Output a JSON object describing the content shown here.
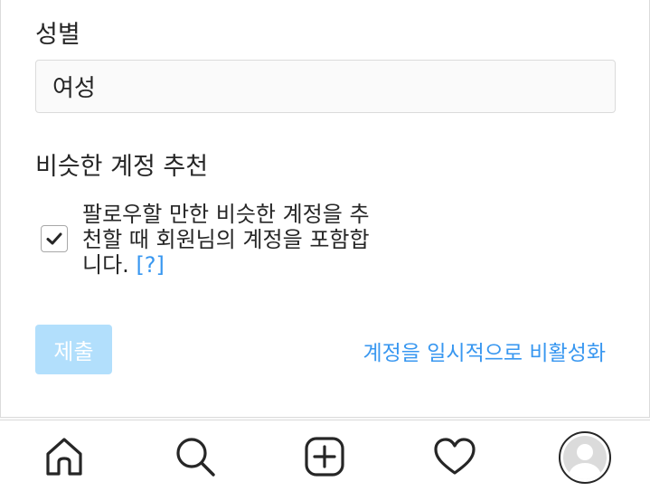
{
  "form": {
    "gender_label": "성별",
    "gender_value": "여성",
    "similar_label": "비슷한 계정 추천",
    "similar_checkbox_checked": true,
    "similar_text": "팔로우할 만한 비슷한 계정을 추천할 때 회원님의 계정을 포함합니다.",
    "help_link": "[?]",
    "submit_label": "제출",
    "deactivate_label": "계정을 일시적으로 비활성화"
  },
  "colors": {
    "link": "#3897f0",
    "submit_disabled": "#b2dffc",
    "border": "#dbdbdb"
  },
  "nav": {
    "items": [
      {
        "icon": "home-icon"
      },
      {
        "icon": "search-icon"
      },
      {
        "icon": "add-post-icon"
      },
      {
        "icon": "heart-icon"
      },
      {
        "icon": "profile-avatar"
      }
    ]
  }
}
